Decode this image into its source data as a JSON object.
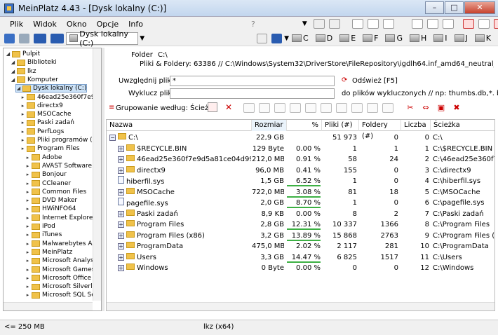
{
  "window": {
    "title": "MeinPlatz 4.43 - [Dysk lokalny (C:)]",
    "buttons": {
      "minimize": "–",
      "maximize": "□",
      "close": "✕"
    }
  },
  "menu": [
    "Plik",
    "Widok",
    "Okno",
    "Opcje",
    "Info"
  ],
  "menu_help": "?",
  "toolbar": {
    "drive_combo": "Dysk lokalny (C:)",
    "drives": [
      "C",
      "D",
      "E",
      "F",
      "G",
      "H",
      "I",
      "J",
      "K"
    ]
  },
  "tree": {
    "items": [
      {
        "label": "Pulpit",
        "level": 0
      },
      {
        "label": "Biblioteki",
        "level": 1
      },
      {
        "label": "lkz",
        "level": 1
      },
      {
        "label": "Komputer",
        "level": 1
      },
      {
        "label": "Dysk lokalny (C:)",
        "level": 2,
        "selected": true
      },
      {
        "label": "46ead25e360f7e9d",
        "level": 3
      },
      {
        "label": "directx9",
        "level": 3
      },
      {
        "label": "MSOCache",
        "level": 3
      },
      {
        "label": "Paski zadań",
        "level": 3
      },
      {
        "label": "PerfLogs",
        "level": 3
      },
      {
        "label": "Pliki programów (x86",
        "level": 3
      },
      {
        "label": "Program Files",
        "level": 3
      },
      {
        "label": "Adobe",
        "level": 4
      },
      {
        "label": "AVAST Software",
        "level": 4
      },
      {
        "label": "Bonjour",
        "level": 4
      },
      {
        "label": "CCleaner",
        "level": 4
      },
      {
        "label": "Common Files",
        "level": 4
      },
      {
        "label": "DVD Maker",
        "level": 4
      },
      {
        "label": "HWiNFO64",
        "level": 4
      },
      {
        "label": "Internet Explorer",
        "level": 4
      },
      {
        "label": "iPod",
        "level": 4
      },
      {
        "label": "iTunes",
        "level": 4
      },
      {
        "label": "Malwarebytes Anti",
        "level": 4
      },
      {
        "label": "MeinPlatz",
        "level": 4
      },
      {
        "label": "Microsoft Analysis",
        "level": 4
      },
      {
        "label": "Microsoft Games",
        "level": 4
      },
      {
        "label": "Microsoft Office",
        "level": 4
      },
      {
        "label": "Microsoft Silverligh",
        "level": 4
      },
      {
        "label": "Microsoft SQL Ser",
        "level": 4
      }
    ]
  },
  "info": {
    "folder_label": "Folder",
    "folder_value": "C:\\",
    "files_line": "Pliki & Foldery: 63386 // C:\\Windows\\System32\\DriverStore\\FileRepository\\igdlh64.inf_amd64_neutral_d684a9bc12f464e3",
    "include_label": "Uwzględnij pliki",
    "include_value": "*",
    "refresh_label": "Odśwież [F5]",
    "exclude_label": "Wyklucz pliki",
    "exclude_value": "",
    "exclude_hint": "do plików wykluczonych // np: thumbs.db,*. bak",
    "grouping_label": "Grupowanie według: Ścieżka"
  },
  "grid": {
    "headers": [
      "Nazwa",
      "Rozmiar",
      "%",
      "Pliki (#)",
      "Foldery (#)",
      "Liczba",
      "Ścieżka"
    ],
    "rows": [
      {
        "name": "C:\\",
        "size": "22,9 GB",
        "pct": "",
        "files": "51 973",
        "folders": "0",
        "count": "0",
        "path": "C:\\",
        "type": "drive"
      },
      {
        "name": "$RECYCLE.BIN",
        "size": "129 Byte",
        "pct": "0.00 %",
        "files": "1",
        "folders": "1",
        "count": "1",
        "path": "C:\\$RECYCLE.BIN",
        "type": "folder"
      },
      {
        "name": "46ead25e360f7e9d5a81ce04d99ca4",
        "size": "212,0 MB",
        "pct": "0.91 %",
        "files": "58",
        "folders": "24",
        "count": "2",
        "path": "C:\\46ead25e360f7e9d5a81",
        "type": "folder"
      },
      {
        "name": "directx9",
        "size": "96,0 MB",
        "pct": "0.41 %",
        "files": "155",
        "folders": "0",
        "count": "3",
        "path": "C:\\directx9",
        "type": "folder"
      },
      {
        "name": "hiberfil.sys",
        "size": "1,5 GB",
        "pct": "6.52 %",
        "files": "1",
        "folders": "0",
        "count": "4",
        "path": "C:\\hiberfil.sys",
        "type": "file"
      },
      {
        "name": "MSOCache",
        "size": "722,0 MB",
        "pct": "3.08 %",
        "files": "81",
        "folders": "18",
        "count": "5",
        "path": "C:\\MSOCache",
        "type": "folder"
      },
      {
        "name": "pagefile.sys",
        "size": "2,0 GB",
        "pct": "8.70 %",
        "files": "1",
        "folders": "0",
        "count": "6",
        "path": "C:\\pagefile.sys",
        "type": "file"
      },
      {
        "name": "Paski zadań",
        "size": "8,9 KB",
        "pct": "0.00 %",
        "files": "8",
        "folders": "2",
        "count": "7",
        "path": "C:\\Paski zadań",
        "type": "folder"
      },
      {
        "name": "Program Files",
        "size": "2,8 GB",
        "pct": "12.31 %",
        "files": "10 337",
        "folders": "1366",
        "count": "8",
        "path": "C:\\Program Files",
        "type": "folder"
      },
      {
        "name": "Program Files (x86)",
        "size": "3,2 GB",
        "pct": "13.89 %",
        "files": "15 868",
        "folders": "2763",
        "count": "9",
        "path": "C:\\Program Files (x86)",
        "type": "folder"
      },
      {
        "name": "ProgramData",
        "size": "475,0 MB",
        "pct": "2.02 %",
        "files": "2 117",
        "folders": "281",
        "count": "10",
        "path": "C:\\ProgramData",
        "type": "folder"
      },
      {
        "name": "Users",
        "size": "3,3 GB",
        "pct": "14.47 %",
        "files": "6 825",
        "folders": "1517",
        "count": "11",
        "path": "C:\\Users",
        "type": "folder"
      },
      {
        "name": "Windows",
        "size": "0 Byte",
        "pct": "0.00 %",
        "files": "0",
        "folders": "0",
        "count": "12",
        "path": "C:\\Windows",
        "type": "folder"
      }
    ]
  },
  "status": {
    "left": "<= 250 MB",
    "center": "lkz (x64)"
  }
}
